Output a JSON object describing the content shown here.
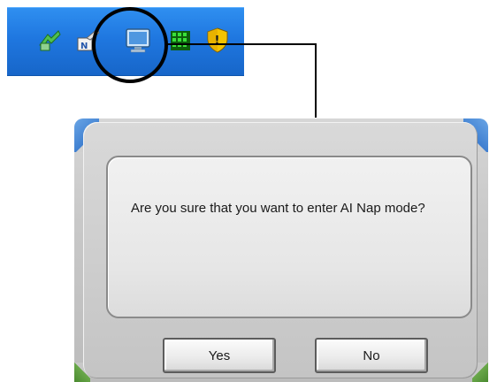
{
  "tray": {
    "icons": [
      {
        "name": "safely-remove-hardware-icon",
        "color": "#3fae3f"
      },
      {
        "name": "network-connection-icon",
        "color": "#e6e6e6"
      },
      {
        "name": "ai-nap-monitor-icon",
        "color": "#8fc3f0"
      },
      {
        "name": "green-grid-icon",
        "color": "#22b822"
      },
      {
        "name": "security-shield-icon",
        "color": "#f2c200"
      }
    ],
    "highlight": "ai-nap-monitor-icon"
  },
  "dialog": {
    "message": "Are you sure that you want to enter AI Nap mode?",
    "yes_label": "Yes",
    "no_label": "No"
  },
  "colors": {
    "taskbar": "#1f77e0",
    "dialog_bg": "#c8c8c8",
    "panel_bg": "#e8e8e8",
    "callout": "#000000"
  }
}
